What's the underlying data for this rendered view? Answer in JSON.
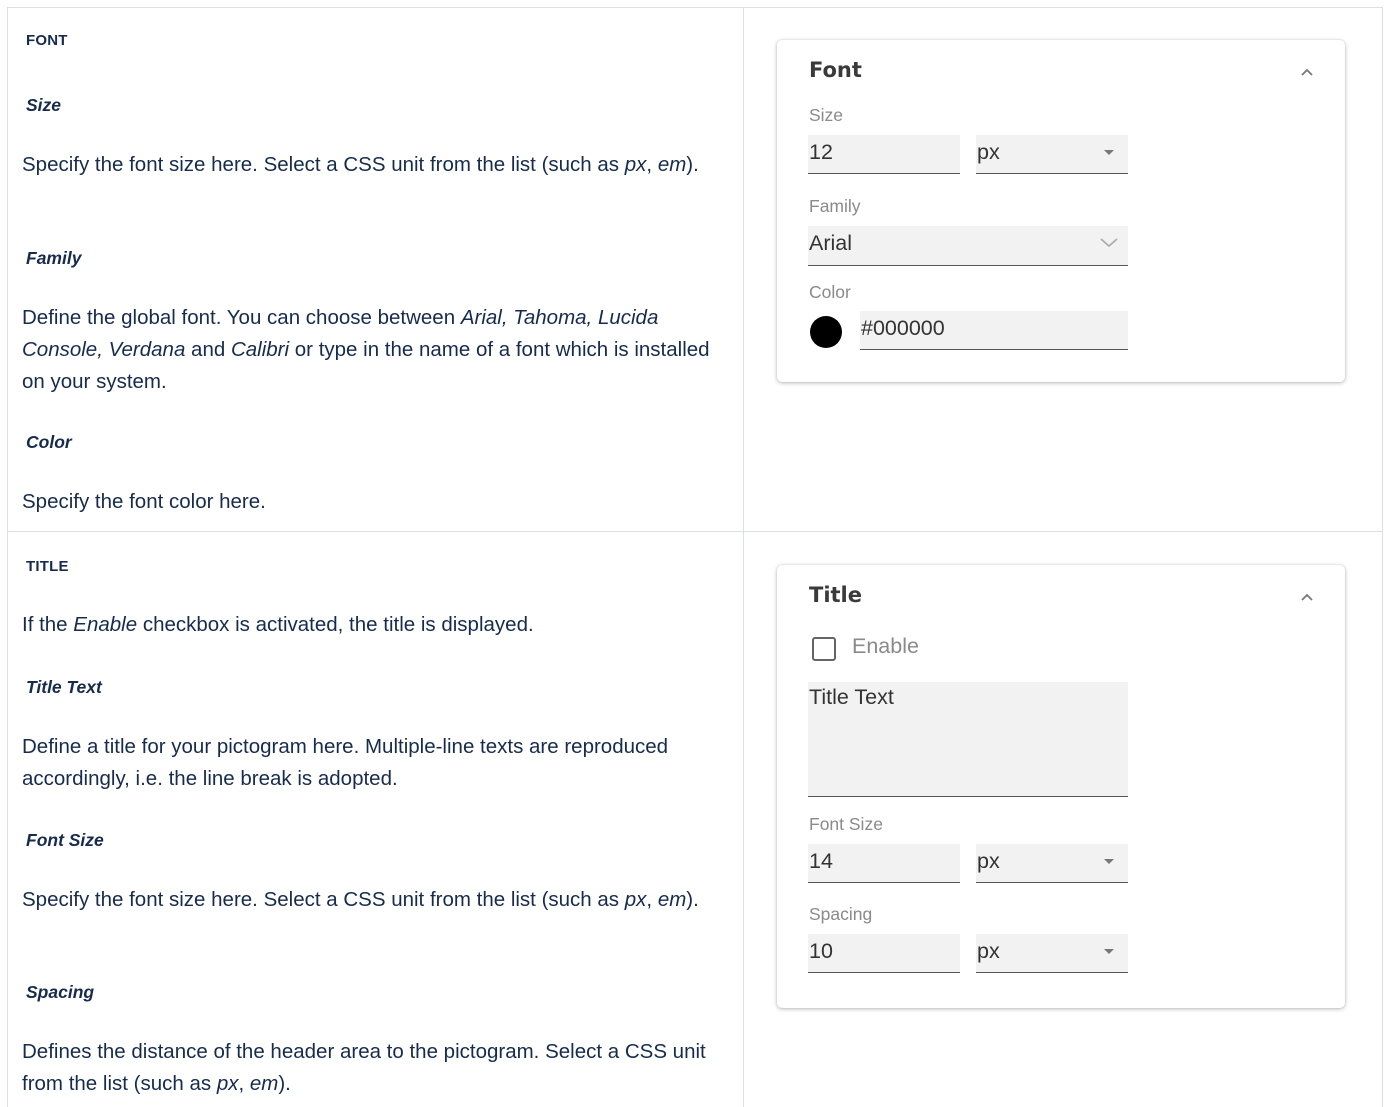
{
  "font_section": {
    "heading": "FONT",
    "size_heading": "Size",
    "size_text": "Specify the font size here. Select a CSS unit from the list (such as px, em).",
    "family_heading": "Family",
    "family_text": "Define the global font. You can choose between Arial, Tahoma, Lucida Console, Verdana and Calibri or type in the name of a font which is installed on your system.",
    "color_heading": "Color",
    "color_text": "Specify the font color here."
  },
  "title_section": {
    "heading": "TITLE",
    "intro_text": "If the Enable checkbox is activated, the title is displayed.",
    "title_text_heading": "Title Text",
    "title_text_desc": "Define a title for your pictogram here. Multiple-line texts are reproduced accordingly, i.e. the line break is adopted.",
    "font_size_heading": "Font Size",
    "font_size_text": "Specify the font size here. Select a CSS unit from the list (such as px, em).",
    "spacing_heading": "Spacing",
    "spacing_text": "Defines the distance of the header area to the pictogram. Select a CSS unit from the list (such as px, em)."
  },
  "font_panel": {
    "title": "Font",
    "size_label": "Size",
    "size_value": "12",
    "size_unit": "px",
    "family_label": "Family",
    "family_value": "Arial",
    "color_label": "Color",
    "color_value": "#000000",
    "color_swatch": "#000000"
  },
  "title_panel": {
    "title": "Title",
    "enable_label": "Enable",
    "enable_checked": false,
    "title_text_placeholder": "Title Text",
    "font_size_label": "Font Size",
    "font_size_value": "14",
    "font_size_unit": "px",
    "spacing_label": "Spacing",
    "spacing_value": "10",
    "spacing_unit": "px"
  },
  "icons": {
    "collapse": "chevron-up-icon",
    "select_caret": "caret-down-icon",
    "family_dropdown": "chevron-down-icon"
  }
}
